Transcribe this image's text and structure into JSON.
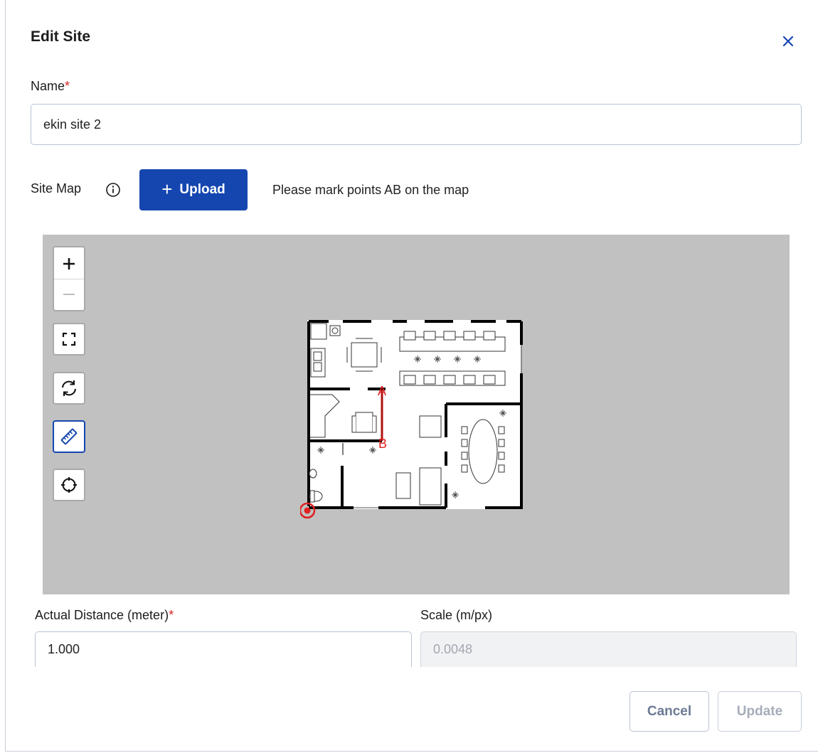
{
  "dialog": {
    "title": "Edit Site"
  },
  "name_field": {
    "label": "Name",
    "required_mark": "*",
    "value": "ekin site 2"
  },
  "site_map": {
    "label": "Site Map",
    "upload_plus": "+",
    "upload_label": "Upload",
    "hint": "Please mark points AB on the map",
    "marker_a": "A",
    "marker_b": "B",
    "controls": [
      "zoom-in",
      "zoom-out",
      "fit-screen",
      "rotate",
      "measure",
      "locate"
    ]
  },
  "distance_field": {
    "label": "Actual Distance (meter)",
    "required_mark": "*",
    "value": "1.000"
  },
  "scale_field": {
    "label": "Scale (m/px)",
    "value": "0.0048"
  },
  "footer": {
    "cancel_label": "Cancel",
    "update_label": "Update"
  },
  "colors": {
    "primary": "#1546b0",
    "required": "#d7262b",
    "map_background": "#c1c1c1",
    "marker": "#e02020"
  }
}
